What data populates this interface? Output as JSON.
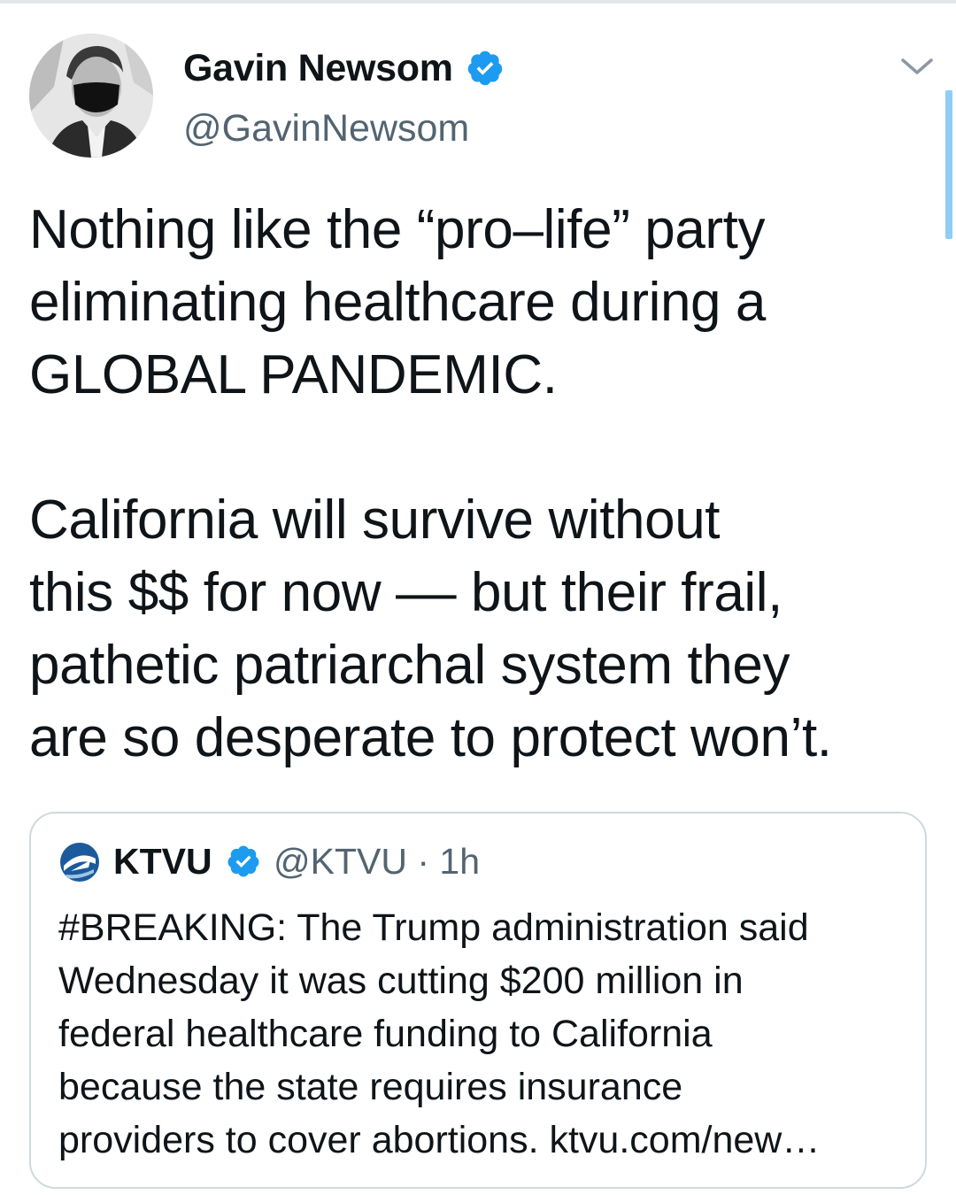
{
  "author": {
    "display_name": "Gavin Newsom",
    "handle": "@GavinNewsom",
    "verified": true,
    "avatar_icon": "profile-photo-masked-man"
  },
  "menu": {
    "icon": "chevron-down-icon"
  },
  "tweet": {
    "paragraph_1": "Nothing like the “pro–life” party\neliminating healthcare during a\nGLOBAL PANDEMIC.",
    "paragraph_2": "California will survive without\nthis $$ for now –– but their frail,\npathetic patriarchal system they\nare so desperate to protect won’t."
  },
  "quote": {
    "logo_icon": "ktvu-2-logo-icon",
    "name": "KTVU",
    "verified": true,
    "meta": "@KTVU · 1h",
    "text": "#BREAKING: The Trump administration said\nWednesday it was cutting $200 million in\nfederal healthcare funding to California\nbecause the state requires insurance\nproviders to cover abortions. ktvu.com/new…"
  },
  "colors": {
    "text": "#0f1419",
    "secondary_text": "#536471",
    "verified_blue": "#1d9bf0",
    "border": "#cfd9de",
    "scrollbar": "#8ecdf7"
  }
}
